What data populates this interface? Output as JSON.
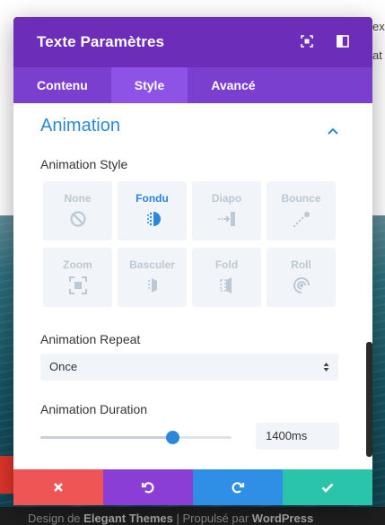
{
  "background": {
    "side_text_1": "ex",
    "side_text_2": "at",
    "footer": {
      "prefix": "Design de ",
      "brand": "Elegant Themes",
      "separator": " | Propulsé par ",
      "platform": "WordPress"
    }
  },
  "modal": {
    "title": "Texte Paramètres",
    "tabs": [
      {
        "label": "Contenu",
        "active": false
      },
      {
        "label": "Style",
        "active": true
      },
      {
        "label": "Avancé",
        "active": false
      }
    ]
  },
  "section": {
    "title": "Animation",
    "expanded": true
  },
  "animation_style": {
    "label": "Animation Style",
    "options": [
      {
        "name": "None",
        "icon": "ban-icon",
        "selected": false
      },
      {
        "name": "Fondu",
        "icon": "fade-icon",
        "selected": true
      },
      {
        "name": "Diapo",
        "icon": "slide-icon",
        "selected": false
      },
      {
        "name": "Bounce",
        "icon": "bounce-icon",
        "selected": false
      },
      {
        "name": "Zoom",
        "icon": "zoom-icon",
        "selected": false
      },
      {
        "name": "Basculer",
        "icon": "flip-icon",
        "selected": false
      },
      {
        "name": "Fold",
        "icon": "fold-icon",
        "selected": false
      },
      {
        "name": "Roll",
        "icon": "roll-icon",
        "selected": false
      }
    ]
  },
  "animation_repeat": {
    "label": "Animation Repeat",
    "value": "Once"
  },
  "animation_duration": {
    "label": "Animation Duration",
    "value": "1400ms",
    "slider_fraction": 0.69
  },
  "footer_actions": [
    {
      "name": "discard",
      "icon": "close-icon"
    },
    {
      "name": "undo",
      "icon": "undo-icon"
    },
    {
      "name": "redo",
      "icon": "redo-icon"
    },
    {
      "name": "save",
      "icon": "check-icon"
    }
  ],
  "colors": {
    "header": "#6c2eb9",
    "tabs": "#7b3fd0",
    "accent": "#2b87da",
    "discard": "#ef5555",
    "undo": "#8a3ed6",
    "redo": "#2f8ee5",
    "save": "#29c4a9"
  }
}
